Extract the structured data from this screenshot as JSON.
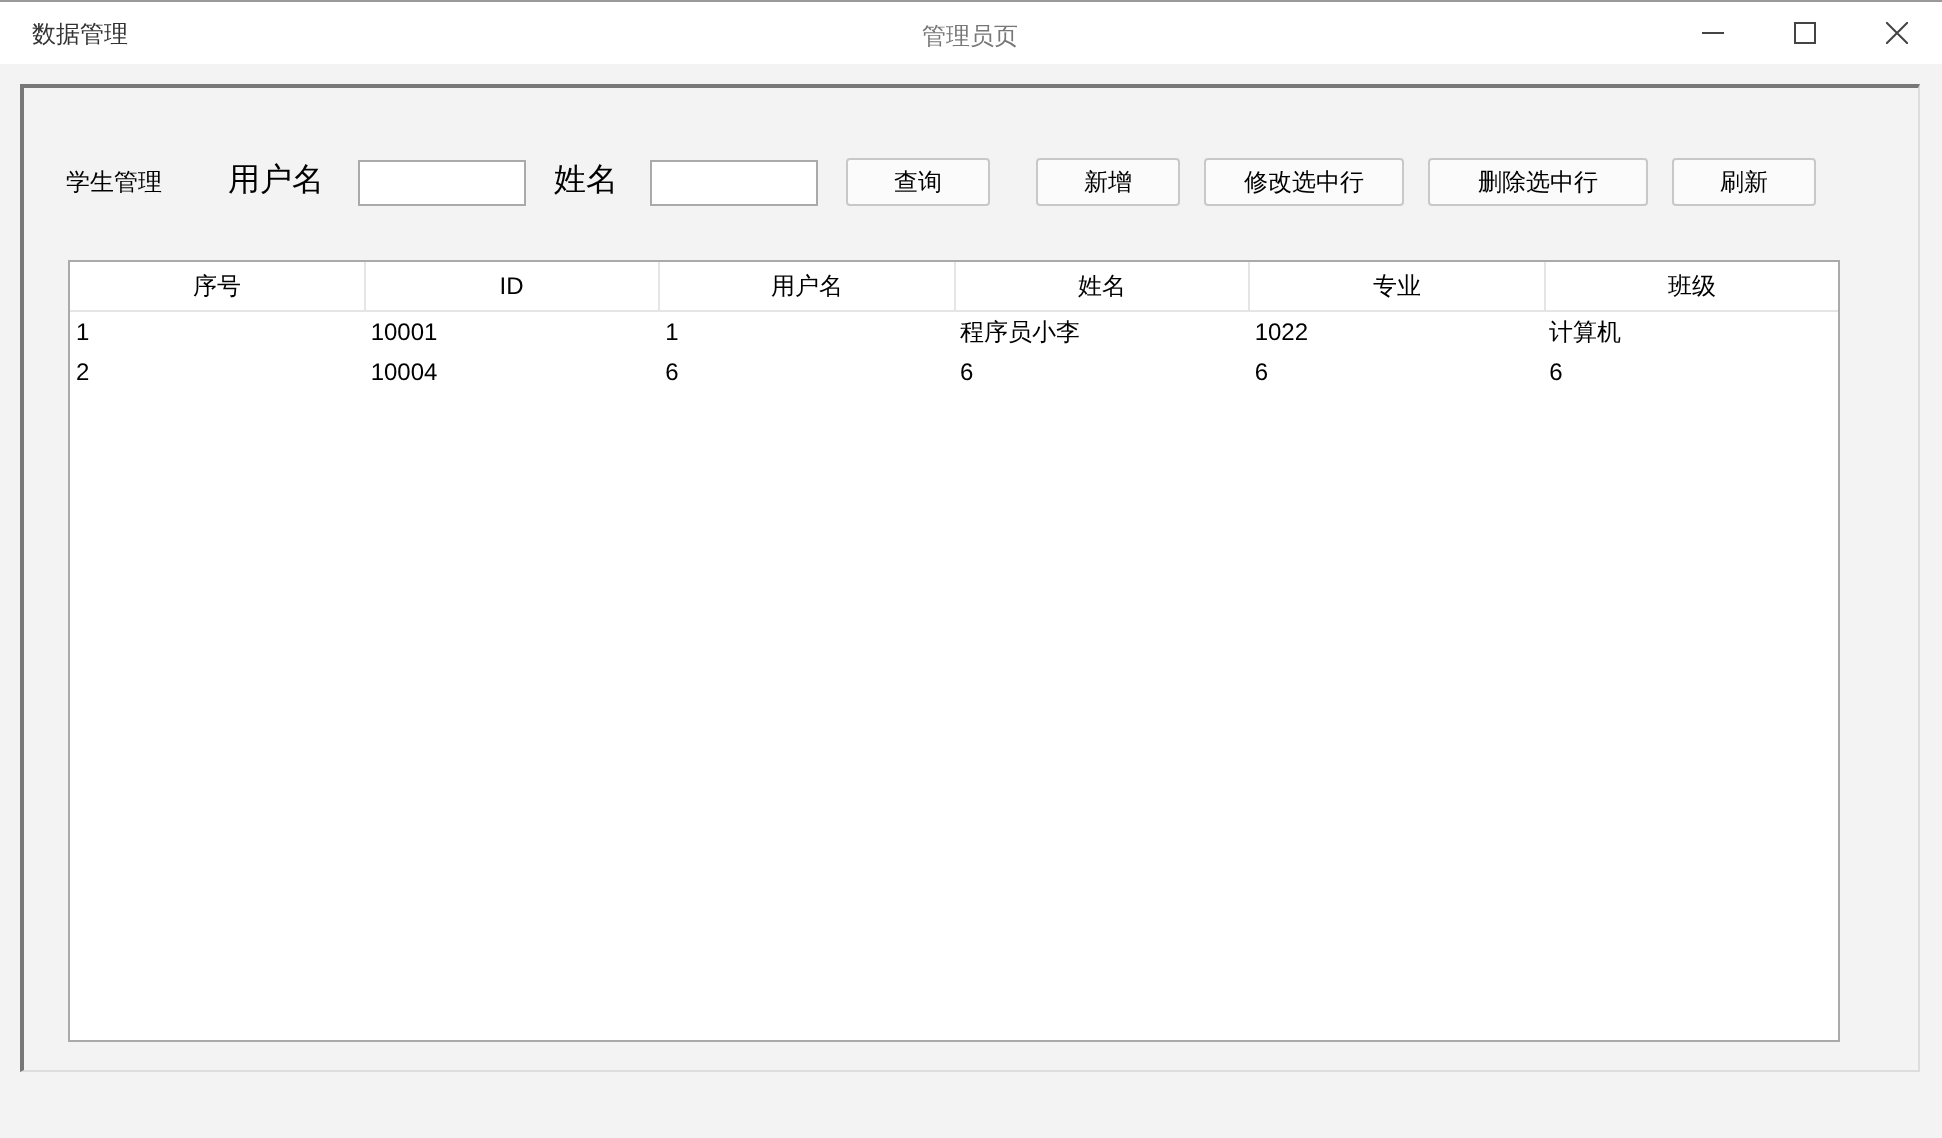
{
  "window": {
    "app_name": "数据管理",
    "title": "管理员页"
  },
  "toolbar": {
    "section_label": "学生管理",
    "fields": [
      {
        "label": "用户名"
      },
      {
        "label": "姓名"
      }
    ],
    "buttons": [
      "查询",
      "新增",
      "修改选中行",
      "删除选中行",
      "刷新"
    ]
  },
  "table": {
    "columns": [
      "序号",
      "ID",
      "用户名",
      "姓名",
      "专业",
      "班级"
    ],
    "rows": [
      [
        "1",
        "10001",
        "1",
        "程序员小李",
        "1022",
        "计算机"
      ],
      [
        "2",
        "10004",
        "6",
        "6",
        "6",
        "6"
      ]
    ]
  }
}
